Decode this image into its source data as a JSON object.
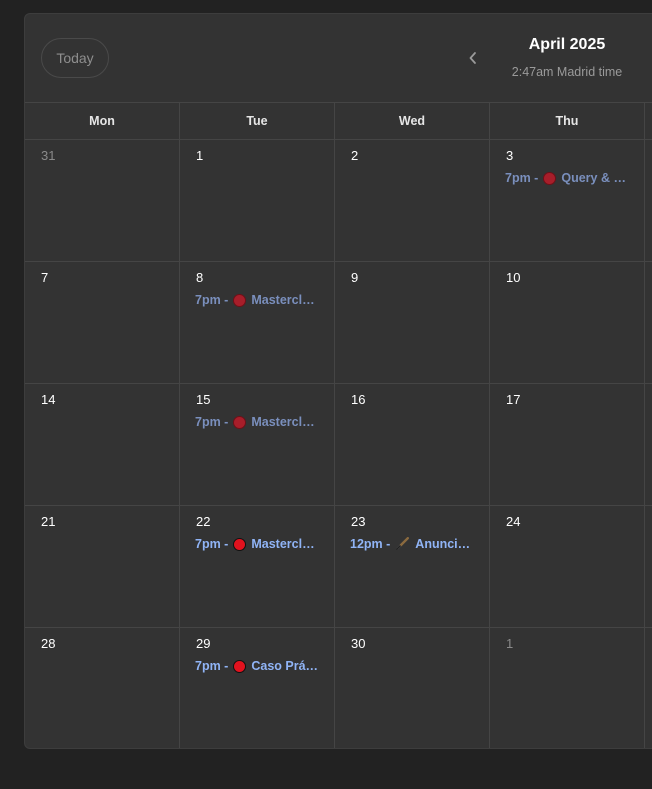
{
  "header": {
    "today_label": "Today",
    "month_title": "April 2025",
    "timezone_label": "2:47am Madrid time"
  },
  "weekdays": [
    "Mon",
    "Tue",
    "Wed",
    "Thu"
  ],
  "weeks": [
    {
      "days": [
        {
          "num": "31",
          "muted": true
        },
        {
          "num": "1"
        },
        {
          "num": "2"
        },
        {
          "num": "3",
          "event": {
            "time": "7pm",
            "icon": "red-circle",
            "title": "Query & …",
            "state": "past"
          }
        }
      ]
    },
    {
      "days": [
        {
          "num": "7"
        },
        {
          "num": "8",
          "event": {
            "time": "7pm",
            "icon": "red-circle",
            "title": "Mastercl…",
            "state": "past"
          }
        },
        {
          "num": "9"
        },
        {
          "num": "10"
        }
      ]
    },
    {
      "days": [
        {
          "num": "14"
        },
        {
          "num": "15",
          "event": {
            "time": "7pm",
            "icon": "red-circle",
            "title": "Mastercl…",
            "state": "past"
          }
        },
        {
          "num": "16"
        },
        {
          "num": "17"
        }
      ]
    },
    {
      "days": [
        {
          "num": "21"
        },
        {
          "num": "22",
          "event": {
            "time": "7pm",
            "icon": "red-circle",
            "title": "Mastercl…",
            "state": "future"
          }
        },
        {
          "num": "23",
          "event": {
            "time": "12pm",
            "icon": "pen-nib",
            "title": "Anunci…",
            "state": "future"
          }
        },
        {
          "num": "24"
        }
      ]
    },
    {
      "days": [
        {
          "num": "28"
        },
        {
          "num": "29",
          "event": {
            "time": "7pm",
            "icon": "red-circle",
            "title": "Caso Prá…",
            "state": "future"
          }
        },
        {
          "num": "30"
        },
        {
          "num": "1",
          "muted": true
        }
      ]
    }
  ],
  "colors": {
    "background": "#222222",
    "panel": "#333333",
    "past_event": "#7a8fbd",
    "future_event": "#90b4f6",
    "event_dot": "#e1121e"
  }
}
